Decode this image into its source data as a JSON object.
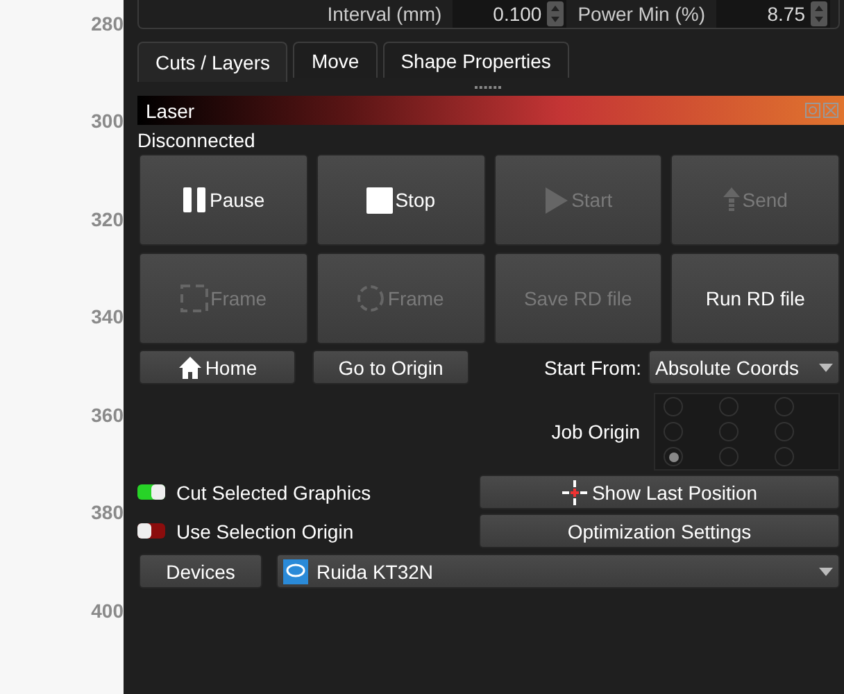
{
  "ruler": {
    "labels": [
      "280",
      "300",
      "320",
      "340",
      "360",
      "380",
      "400"
    ]
  },
  "settings_row": {
    "fields": [
      {
        "label": "Interval (mm)",
        "value": "0.100"
      },
      {
        "label": "Power Min (%)",
        "value": "8.75"
      }
    ]
  },
  "tabs": [
    {
      "label": "Cuts / Layers",
      "selected": true
    },
    {
      "label": "Move",
      "selected": false
    },
    {
      "label": "Shape Properties",
      "selected": false
    }
  ],
  "panel": {
    "title": "Laser",
    "status": "Disconnected"
  },
  "actions": [
    {
      "label": "Pause",
      "kind": "pause",
      "disabled": false
    },
    {
      "label": "Stop",
      "kind": "stop",
      "disabled": false
    },
    {
      "label": "Start",
      "kind": "play",
      "disabled": true
    },
    {
      "label": "Send",
      "kind": "upload",
      "disabled": true
    },
    {
      "label": "Frame",
      "kind": "frame",
      "disabled": true
    },
    {
      "label": "Frame",
      "kind": "roundframe",
      "disabled": true
    },
    {
      "label": "Save RD file",
      "kind": "text",
      "disabled": true
    },
    {
      "label": "Run RD file",
      "kind": "text",
      "disabled": false
    }
  ],
  "home_button": "Home",
  "origin_button": "Go to Origin",
  "start_from": {
    "label": "Start From:",
    "value": "Absolute Coords"
  },
  "job_origin": {
    "label": "Job Origin",
    "points": [
      {
        "selected": false
      },
      {
        "selected": false
      },
      {
        "selected": false
      },
      {
        "selected": false
      },
      {
        "selected": false
      },
      {
        "selected": false
      },
      {
        "selected": true
      },
      {
        "selected": false
      },
      {
        "selected": false
      }
    ]
  },
  "toggles": [
    {
      "label": "Cut Selected Graphics",
      "on": true
    },
    {
      "label": "Use Selection Origin",
      "on": false
    }
  ],
  "show_last_position": "Show Last Position",
  "optimization_button": "Optimization Settings",
  "devices_button": "Devices",
  "device_select": {
    "value": "Ruida KT32N"
  }
}
